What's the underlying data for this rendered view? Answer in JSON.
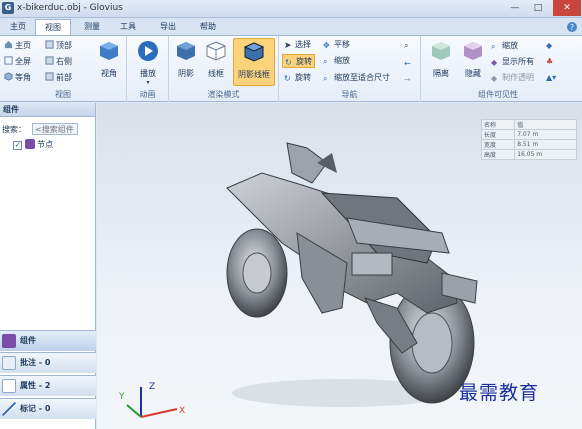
{
  "window": {
    "title": "x-bikerduc.obj - Glovius",
    "app_icon_text": "G",
    "min_label": "—",
    "max_label": "□",
    "close_label": "✕"
  },
  "tabs": [
    "主页",
    "视图",
    "测量",
    "工具",
    "导出",
    "帮助"
  ],
  "ribbon": {
    "view_group": {
      "label": "视图",
      "buttons": [
        "主页",
        "顶部",
        "全屏",
        "右侧",
        "等角",
        "前部"
      ],
      "big_label": "视角"
    },
    "animation_group": {
      "label": "动画",
      "play_label": "播放"
    },
    "render_group": {
      "label": "渲染模式",
      "buttons": [
        "阴影",
        "线框",
        "阴影线框"
      ]
    },
    "nav_group": {
      "label": "导航",
      "buttons": [
        "选择",
        "平移",
        "旋转",
        "缩放",
        "旋转",
        "缩放至适合尺寸"
      ]
    },
    "visibility_group": {
      "label": "组件可见性",
      "buttons": [
        "隔离",
        "隐藏"
      ],
      "small_buttons": [
        "缩放",
        "显示所有",
        "制作透明"
      ]
    }
  },
  "left_panel": {
    "header": "组件",
    "search_label": "搜索：",
    "search_placeholder": "<搜索组件",
    "tree_node": "节点",
    "tabs": [
      "组件",
      "批注 - 0",
      "属性 - 2",
      "标记 - 0"
    ]
  },
  "viewport": {
    "info_rows": [
      [
        "名称",
        "值"
      ],
      [
        "长度",
        "7.07 m"
      ],
      [
        "宽度",
        "8.51 m"
      ],
      [
        "高度",
        "16.05 m"
      ]
    ],
    "axis_labels": {
      "x": "X",
      "y": "Y",
      "z": "Z"
    },
    "watermark": "最需教育"
  },
  "colors": {
    "accent": "#2a6ebb",
    "selected_button": "#fcd27a",
    "close_button": "#c9463d",
    "axis_x": "#d83a2e",
    "axis_y": "#2e9a2e",
    "axis_z": "#1d2f9b",
    "watermark": "#1b2f9b"
  }
}
